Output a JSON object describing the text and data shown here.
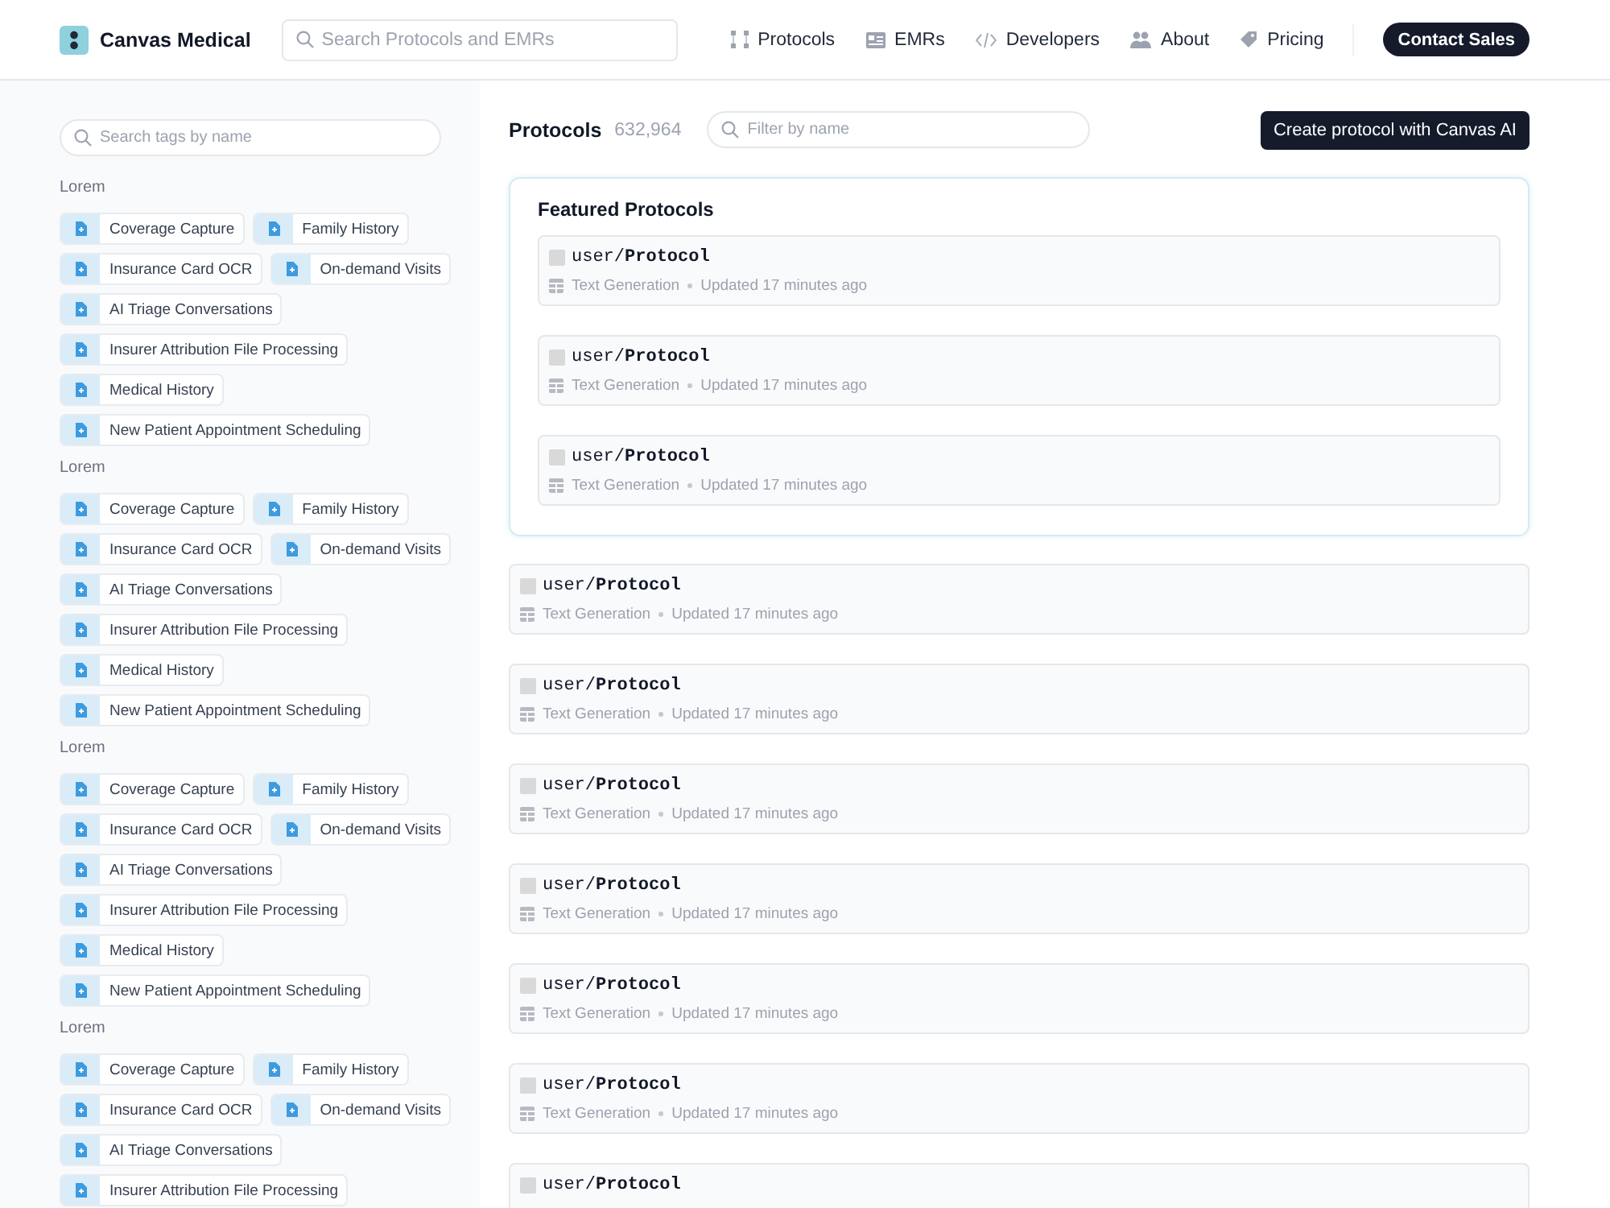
{
  "header": {
    "logo": "Canvas Medical",
    "search": {
      "placeholder": "Search Protocols and EMRs"
    },
    "nav": [
      "Protocols",
      "EMRs",
      "Developers",
      "About",
      "Pricing"
    ],
    "cta": "Contact Sales"
  },
  "sidebar": {
    "search": {
      "placeholder": "Search tags by name"
    },
    "groups": [
      {
        "title": "Lorem",
        "tags": [
          "Coverage Capture",
          "Family History",
          "Insurance Card OCR",
          "On-demand Visits",
          "AI Triage Conversations",
          "Insurer Attribution File Processing",
          "Medical History",
          "New Patient Appointment Scheduling"
        ]
      },
      {
        "title": "Lorem",
        "tags": [
          "Coverage Capture",
          "Family History",
          "Insurance Card OCR",
          "On-demand Visits",
          "AI Triage Conversations",
          "Insurer Attribution File Processing",
          "Medical History",
          "New Patient Appointment Scheduling"
        ]
      },
      {
        "title": "Lorem",
        "tags": [
          "Coverage Capture",
          "Family History",
          "Insurance Card OCR",
          "On-demand Visits",
          "AI Triage Conversations",
          "Insurer Attribution File Processing",
          "Medical History",
          "New Patient Appointment Scheduling"
        ]
      },
      {
        "title": "Lorem",
        "tags": [
          "Coverage Capture",
          "Family History",
          "Insurance Card OCR",
          "On-demand Visits",
          "AI Triage Conversations",
          "Insurer Attribution File Processing"
        ]
      }
    ]
  },
  "main": {
    "title": "Protocols",
    "count": "632,964",
    "filter": {
      "placeholder": "Filter by name"
    },
    "create_button": "Create protocol with Canvas AI",
    "featured": {
      "title": "Featured Protocols",
      "items": [
        {
          "name": "user/**Protocol**",
          "type": "Text Generation",
          "updated": "Updated 17 minutes ago"
        },
        {
          "name": "user/**Protocol**",
          "type": "Text Generation",
          "updated": "Updated 17 minutes ago"
        },
        {
          "name": "user/**Protocol**",
          "type": "Text Generation",
          "updated": "Updated 17 minutes ago"
        }
      ]
    },
    "items": [
      {
        "name": "user/**Protocol**",
        "type": "Text Generation",
        "updated": "Updated 17 minutes ago"
      },
      {
        "name": "user/**Protocol**",
        "type": "Text Generation",
        "updated": "Updated 17 minutes ago"
      },
      {
        "name": "user/**Protocol**",
        "type": "Text Generation",
        "updated": "Updated 17 minutes ago"
      },
      {
        "name": "user/**Protocol**",
        "type": "Text Generation",
        "updated": "Updated 17 minutes ago"
      },
      {
        "name": "user/**Protocol**",
        "type": "Text Generation",
        "updated": "Updated 17 minutes ago"
      },
      {
        "name": "user/**Protocol**",
        "type": "Text Generation",
        "updated": "Updated 17 minutes ago"
      },
      {
        "name": "user/**Protocol**"
      }
    ]
  }
}
